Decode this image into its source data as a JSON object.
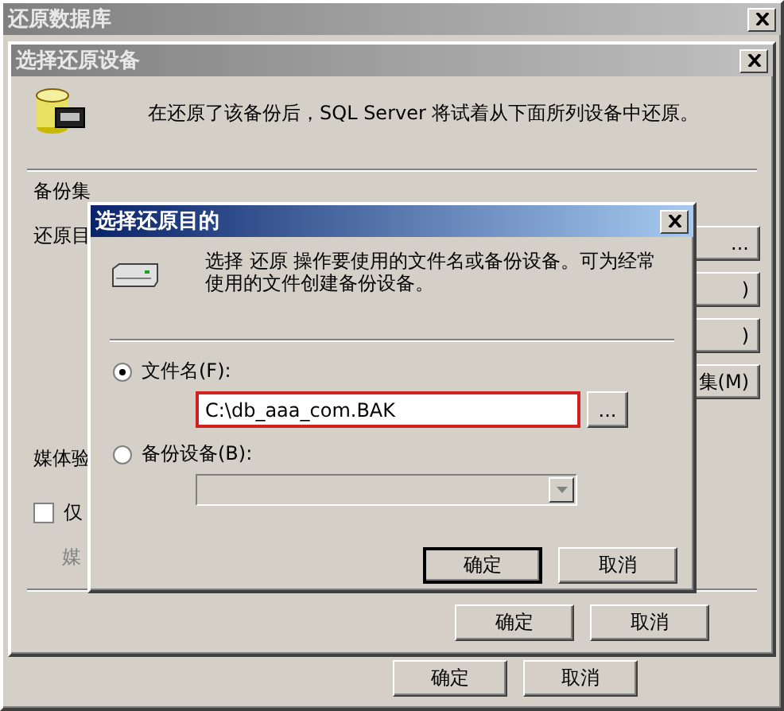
{
  "restore_database": {
    "title": "还原数据库",
    "active": false,
    "buttons": [
      "确定",
      "取消"
    ]
  },
  "select_device": {
    "title": "选择还原设备",
    "active": false,
    "message": "在还原了该备份后，SQL Server 将试着从下面所列设备中还原。",
    "labels": [
      {
        "text": "备份集",
        "disabled": false
      },
      {
        "text": "还原目",
        "disabled": false
      }
    ],
    "side_buttons": [
      "...",
      ")",
      ")",
      "集(M)"
    ],
    "media_label": "媒体验",
    "checkbox": {
      "label": "仅",
      "checked": false
    },
    "sub_label": {
      "text": "媒",
      "disabled": true
    },
    "buttons": [
      "确定",
      "取消"
    ]
  },
  "select_destination": {
    "title": "选择还原目的",
    "active": true,
    "message": "选择 还原 操作要使用的文件名或备份设备。可为经常使用的文件创建备份设备。",
    "options": [
      {
        "kind": "file",
        "label": "文件名(F):",
        "selected": true,
        "value": "C:\\db_aaa_com.BAK",
        "browse": "..."
      },
      {
        "kind": "device",
        "label": "备份设备(B):",
        "selected": false,
        "disabled": true
      }
    ],
    "buttons": [
      "确定",
      "取消"
    ]
  }
}
